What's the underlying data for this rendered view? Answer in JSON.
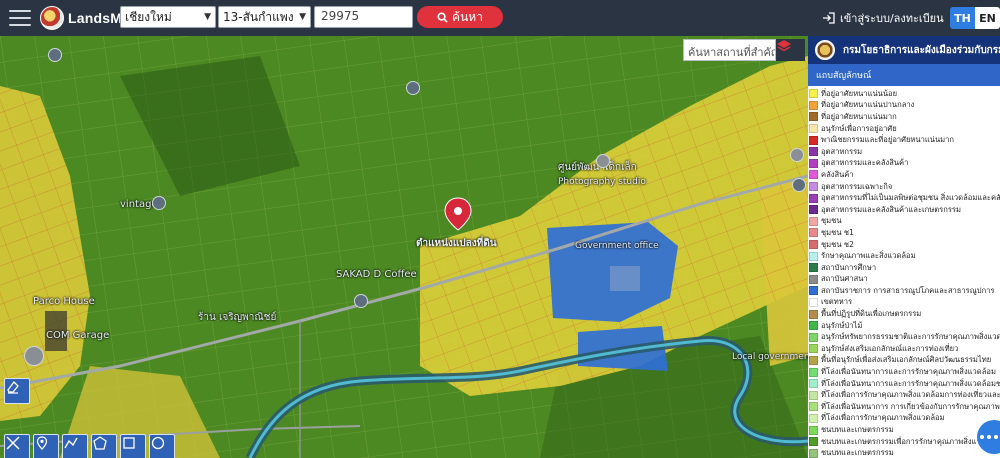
{
  "app": {
    "title": "LandsMaps"
  },
  "search": {
    "province": "เชียงใหม่",
    "district": "13-สันกำแพง",
    "parcel_number": "29975",
    "button_label": "ค้นหา"
  },
  "header": {
    "login_label": "เข้าสู่ระบบ/ลงทะเบียน",
    "lang_th": "TH",
    "lang_en": "EN"
  },
  "map": {
    "search_placeholder": "ค้นหาสถานที่สำคัญ",
    "marker_label": "ตำแหน่งแปลงที่ดิน",
    "places": [
      "ศูนย์พัฒนาเด็กเล็ก",
      "Photography studio",
      "vintage",
      "Government office",
      "SAKAD D Coffee",
      "Parco House",
      "COM Garage",
      "ร้าน เจริญพาณิชย์",
      "Local government"
    ]
  },
  "legend": {
    "header": "กรมโยธาธิการและผังเมืองร่วมกับกรมที่ดิน",
    "subheader": "แถบสัญลักษณ์",
    "items": [
      {
        "label": "ที่อยู่อาศัยหนาแน่นน้อย",
        "color": "#f7f04a"
      },
      {
        "label": "ที่อยู่อาศัยหนาแน่นปานกลาง",
        "color": "#f2a23a"
      },
      {
        "label": "ที่อยู่อาศัยหนาแน่นมาก",
        "color": "#a26a2a"
      },
      {
        "label": "อนุรักษ์เพื่อการอยู่อาศัย",
        "color": "#f6e6a8"
      },
      {
        "label": "พาณิชยกรรมและที่อยู่อาศัยหนาแน่นมาก",
        "color": "#d72828"
      },
      {
        "label": "อุตสาหกรรม",
        "color": "#8a35a6"
      },
      {
        "label": "อุตสาหกรรมและคลังสินค้า",
        "color": "#b23fc0"
      },
      {
        "label": "คลังสินค้า",
        "color": "#e15ad9"
      },
      {
        "label": "อุตสาหกรรมเฉพาะกิจ",
        "color": "#c58be0"
      },
      {
        "label": "อุตสาหกรรมที่ไม่เป็นมลพิษต่อชุมชน สิ่งแวดล้อมและคลังสินค้า",
        "color": "#9b3fb5"
      },
      {
        "label": "อุตสาหกรรมและคลังสินค้าและเกษตรกรรม",
        "color": "#6b2a8c"
      },
      {
        "label": "ชุมชน",
        "color": "#f2a7a7"
      },
      {
        "label": "ชุมชน ช1",
        "color": "#e88a8a"
      },
      {
        "label": "ชุมชน ช2",
        "color": "#d86d6d"
      },
      {
        "label": "รักษาคุณภาพและสิ่งแวดล้อม",
        "color": "#b8f0f0"
      },
      {
        "label": "สถาบันการศึกษา",
        "color": "#2b7a4a"
      },
      {
        "label": "สถาบันศาสนา",
        "color": "#8c8c8c"
      },
      {
        "label": "สถาบันราชการ การสาธารณูปโภคและสาธารณูปการ",
        "color": "#2f6fd6"
      },
      {
        "label": "เขตทหาร",
        "color": "#ffffff"
      },
      {
        "label": "พื้นที่ปฏิรูปที่ดินเพื่อเกษตรกรรม",
        "color": "#b48a4e"
      },
      {
        "label": "อนุรักษ์ป่าไม้",
        "color": "#3fb84a"
      },
      {
        "label": "อนุรักษ์ทรัพยากรธรรมชาติและการรักษาคุณภาพสิ่งแวดล้อม",
        "color": "#7fd36a"
      },
      {
        "label": "อนุรักษ์ส่งเสริมเอกลักษณ์และการท่องเที่ยว",
        "color": "#9ad65a"
      },
      {
        "label": "พื้นที่อนุรักษ์เพื่อส่งเสริมเอกลักษณ์ศิลปวัฒนธรรมไทย",
        "color": "#b6a24a"
      },
      {
        "label": "ที่โล่งเพื่อนันทนาการและการรักษาคุณภาพสิ่งแวดล้อม",
        "color": "#6fe06f"
      },
      {
        "label": "ที่โล่งเพื่อนันทนาการและการรักษาคุณภาพสิ่งแวดล้อมชายฝั่ง",
        "color": "#9ef0c8"
      },
      {
        "label": "ที่โล่งเพื่อการรักษาคุณภาพสิ่งแวดล้อมการท่องเที่ยวและ",
        "color": "#c2e6a0"
      },
      {
        "label": "ที่โล่งเพื่อนันทนาการ การเกี่ยวข้องกับการรักษาคุณภาพ",
        "color": "#a8e07a"
      },
      {
        "label": "ที่โล่งเพื่อการรักษาคุณภาพสิ่งแวดล้อม",
        "color": "#d0f0b0"
      },
      {
        "label": "ชนบทและเกษตรกรรม",
        "color": "#7ed957"
      },
      {
        "label": "ชนบทและเกษตรกรรมเพื่อการรักษาคุณภาพสิ่งแวดล้อม",
        "color": "#4f9d2a"
      },
      {
        "label": "ชนบทและเกษตรกรรม",
        "color": "#93c47d"
      }
    ]
  },
  "icons": {
    "menu": "hamburger-icon",
    "search": "magnifier-icon",
    "login": "sign-in-icon",
    "layers": "layers-icon",
    "marker": "map-pin-icon",
    "chat": "ellipsis-icon"
  }
}
